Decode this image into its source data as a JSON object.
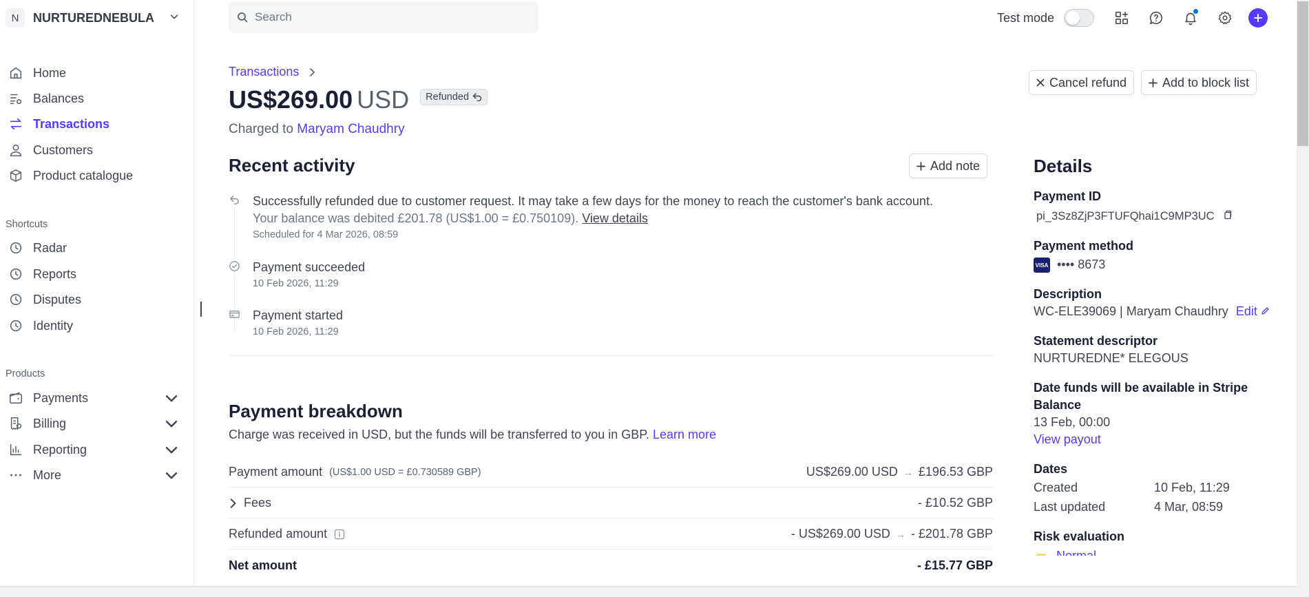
{
  "sidebar": {
    "account": {
      "initial": "N",
      "name": "NURTUREDNEBULA ..."
    },
    "nav": [
      {
        "label": "Home",
        "icon": "home-icon"
      },
      {
        "label": "Balances",
        "icon": "balances-icon"
      },
      {
        "label": "Transactions",
        "icon": "transactions-icon",
        "active": true
      },
      {
        "label": "Customers",
        "icon": "customers-icon"
      },
      {
        "label": "Product catalogue",
        "icon": "product-icon"
      }
    ],
    "shortcuts_label": "Shortcuts",
    "shortcuts": [
      "Radar",
      "Reports",
      "Disputes",
      "Identity"
    ],
    "products_label": "Products",
    "products": [
      "Payments",
      "Billing",
      "Reporting",
      "More"
    ]
  },
  "topbar": {
    "search_placeholder": "Search",
    "test_mode_label": "Test mode"
  },
  "payment": {
    "breadcrumb": "Transactions",
    "amount": "US$269.00",
    "currency": "USD",
    "status_badge": "Refunded",
    "charged_to_prefix": "Charged to",
    "customer_name": "Maryam Chaudhry",
    "cancel_refund": "Cancel refund",
    "add_block": "Add to block list"
  },
  "activity": {
    "title": "Recent activity",
    "add_note": "Add note",
    "events": [
      {
        "main": "Successfully refunded due to customer request. It may take a few days for the money to reach the customer's bank account.",
        "sub": "Your balance was debited £201.78 (US$1.00 = £0.750109).",
        "link": "View details",
        "date": "Scheduled for 4 Mar 2026, 08:59"
      },
      {
        "main": "Payment succeeded",
        "date": "10 Feb 2026, 11:29"
      },
      {
        "main": "Payment started",
        "date": "10 Feb 2026, 11:29"
      }
    ]
  },
  "breakdown": {
    "title": "Payment breakdown",
    "subtitle": "Charge was received in USD, but the funds will be transferred to you in GBP.",
    "learn_more": "Learn more",
    "rows": [
      {
        "label": "Payment amount",
        "note": "(US$1.00 USD = £0.730589 GBP)",
        "from": "US$269.00 USD",
        "to": "£196.53 GBP"
      },
      {
        "label": "Fees",
        "value": "- £10.52 GBP"
      },
      {
        "label": "Refunded amount",
        "from": "- US$269.00 USD",
        "to": "- £201.78 GBP"
      },
      {
        "label": "Net amount",
        "value": "- £15.77 GBP"
      }
    ]
  },
  "details": {
    "title": "Details",
    "payment_id_label": "Payment ID",
    "payment_id": "pi_3Sz8ZjP3FTUFQhai1C9MP3UC",
    "payment_method_label": "Payment method",
    "card_brand": "VISA",
    "card_last4": "•••• 8673",
    "description_label": "Description",
    "description": "WC-ELE39069 | Maryam Chaudhry",
    "edit": "Edit",
    "statement_label": "Statement descriptor",
    "statement": "NURTUREDNE* ELEGOUS",
    "funds_label": "Date funds will be available in Stripe Balance",
    "funds_date": "13 Feb, 00:00",
    "view_payout": "View payout",
    "dates_label": "Dates",
    "created_label": "Created",
    "created": "10 Feb, 11:29",
    "updated_label": "Last updated",
    "updated": "4 Mar, 08:59",
    "risk_label": "Risk evaluation",
    "risk_value": "Normal"
  }
}
